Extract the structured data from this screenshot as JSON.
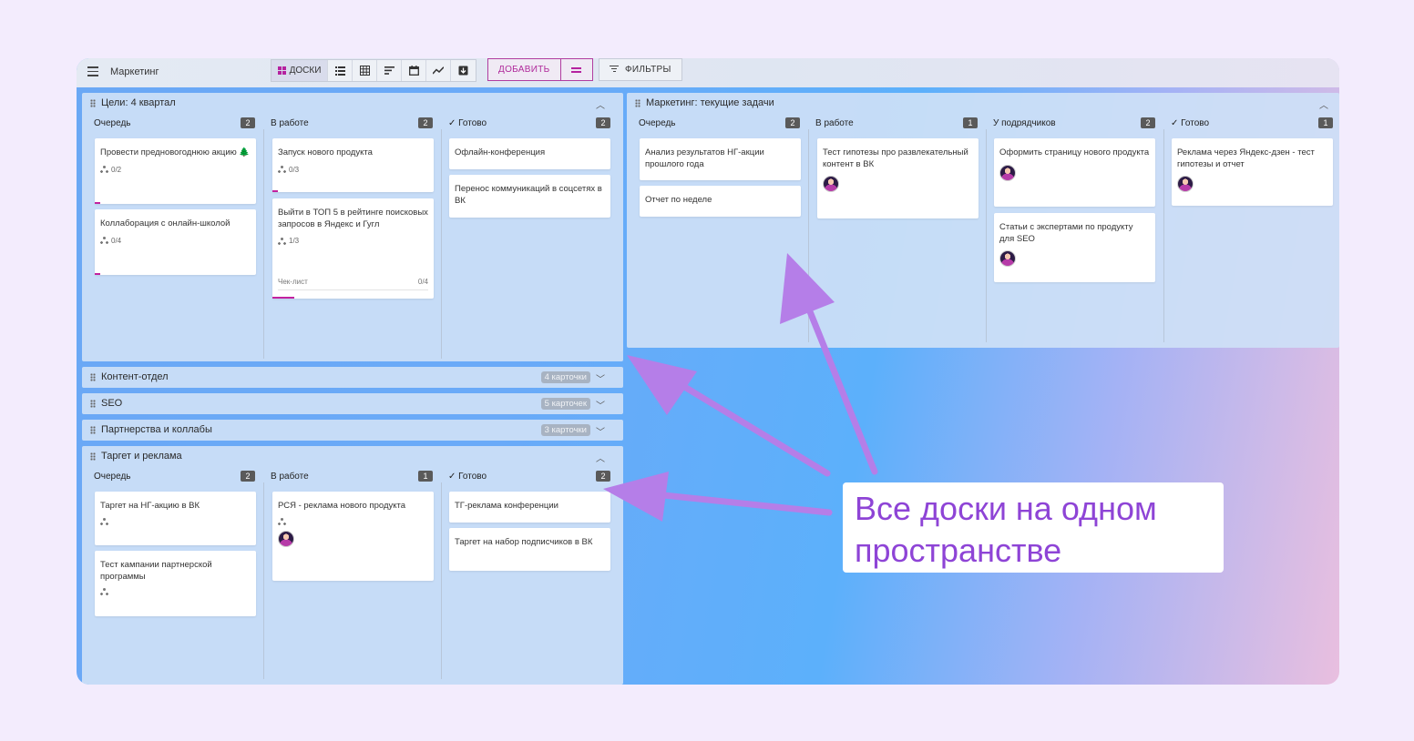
{
  "app": {
    "title": "Маркетинг",
    "view_boards_label": "ДОСКИ",
    "add_label": "ДОБАВИТЬ",
    "filters_label": "ФИЛЬТРЫ",
    "accent_color": "#b5219f"
  },
  "boards": {
    "goals": {
      "title": "Цели: 4 квартал",
      "columns": [
        {
          "title": "Очередь",
          "count": "2"
        },
        {
          "title": "В работе",
          "count": "2"
        },
        {
          "title": "✓ Готово",
          "count": "2"
        }
      ],
      "cards": {
        "c1": {
          "text": "Провести предновогоднюю акцию 🌲",
          "sub": "0/2"
        },
        "c2": {
          "text": "Коллаборация с онлайн-школой",
          "sub": "0/4"
        },
        "c3": {
          "text": "Запуск нового продукта",
          "sub": "0/3"
        },
        "c4": {
          "text": "Выйти в ТОП 5 в рейтинге поисковых запросов в Яндекс и Гугл",
          "sub": "1/3",
          "checklist_label": "Чек-лист",
          "checklist_value": "0/4"
        },
        "c5": {
          "text": "Офлайн-конференция"
        },
        "c6": {
          "text": "Перенос коммуникаций в соцсетях в ВК"
        }
      }
    },
    "marketing": {
      "title": "Маркетинг: текущие задачи",
      "columns": [
        {
          "title": "Очередь",
          "count": "2"
        },
        {
          "title": "В работе",
          "count": "1"
        },
        {
          "title": "У подрядчиков",
          "count": "2"
        },
        {
          "title": "✓ Готово",
          "count": "1"
        }
      ],
      "cards": {
        "c1": {
          "text": "Анализ результатов НГ-акции прошлого года"
        },
        "c2": {
          "text": "Отчет по неделе"
        },
        "c3": {
          "text": "Тест гипотезы про развлекательный контент в ВК"
        },
        "c4": {
          "text": "Оформить страницу нового продукта"
        },
        "c5": {
          "text": "Статьи с экспертами по продукту для SEO"
        },
        "c6": {
          "text": "Реклама через Яндекс-дзен - тест гипотезы и отчет"
        }
      }
    },
    "content": {
      "title": "Контент-отдел",
      "count_label": "4 карточки"
    },
    "seo": {
      "title": "SEO",
      "count_label": "5 карточек"
    },
    "partners": {
      "title": "Партнерства и коллабы",
      "count_label": "3 карточки"
    },
    "target": {
      "title": "Таргет и реклама",
      "columns": [
        {
          "title": "Очередь",
          "count": "2"
        },
        {
          "title": "В работе",
          "count": "1"
        },
        {
          "title": "✓ Готово",
          "count": "2"
        }
      ],
      "cards": {
        "c1": {
          "text": "Таргет на НГ-акцию в ВК"
        },
        "c2": {
          "text": "Тест кампании партнерской программы"
        },
        "c3": {
          "text": "РСЯ - реклама нового продукта"
        },
        "c4": {
          "text": "ТГ-реклама конференции"
        },
        "c5": {
          "text": "Таргет на набор подписчиков в ВК"
        }
      }
    }
  },
  "callout": {
    "text": "Все доски на одном пространстве",
    "color": "#8e44d6",
    "arrow_color": "#b57ee8"
  }
}
